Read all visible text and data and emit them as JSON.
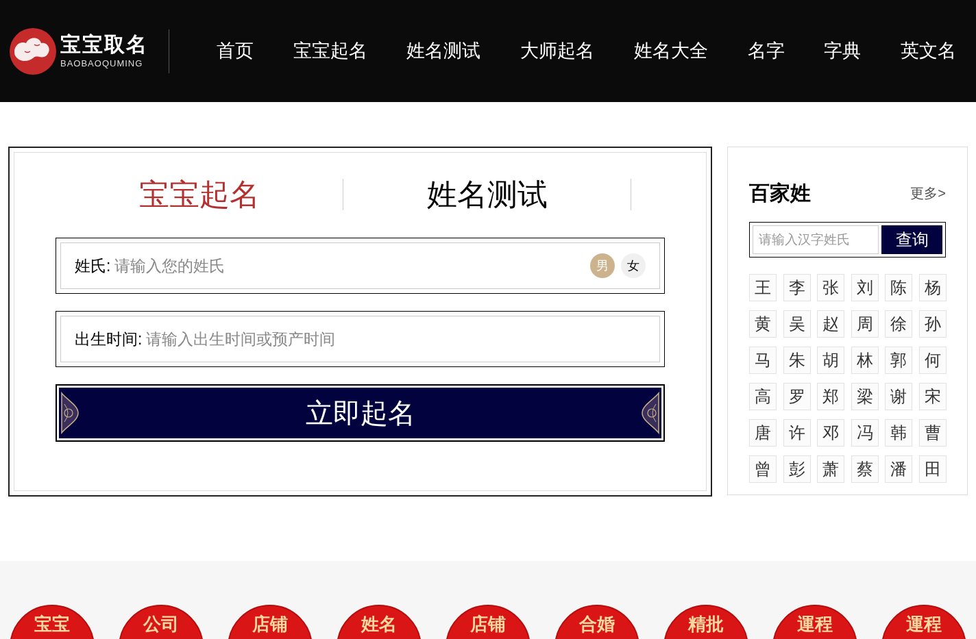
{
  "logo": {
    "title": "宝宝取名",
    "subtitle": "BAOBAOQUMING"
  },
  "nav": [
    "首页",
    "宝宝起名",
    "姓名测试",
    "大师起名",
    "姓名大全",
    "名字",
    "字典",
    "英文名"
  ],
  "form": {
    "tabs": [
      {
        "label": "宝宝起名",
        "selected": true
      },
      {
        "label": "姓名测试",
        "selected": false
      }
    ],
    "surname": {
      "label": "姓氏:",
      "placeholder": "请输入您的姓氏"
    },
    "genders": [
      {
        "label": "男",
        "selected": true
      },
      {
        "label": "女",
        "selected": false
      }
    ],
    "birth": {
      "label": "出生时间:",
      "placeholder": "请输入出生时间或预产时间"
    },
    "submit": "立即起名"
  },
  "surnames": {
    "title": "百家姓",
    "more": "更多>",
    "placeholder": "请输入汉字姓氏",
    "search": "查询",
    "items": [
      "王",
      "李",
      "张",
      "刘",
      "陈",
      "杨",
      "黄",
      "吴",
      "赵",
      "周",
      "徐",
      "孙",
      "马",
      "朱",
      "胡",
      "林",
      "郭",
      "何",
      "高",
      "罗",
      "郑",
      "梁",
      "谢",
      "宋",
      "唐",
      "许",
      "邓",
      "冯",
      "韩",
      "曹",
      "曾",
      "彭",
      "萧",
      "蔡",
      "潘",
      "田"
    ]
  },
  "seals": [
    "宝宝",
    "公司",
    "店铺",
    "姓名",
    "店铺",
    "合婚",
    "精批",
    "運程",
    "運程"
  ]
}
